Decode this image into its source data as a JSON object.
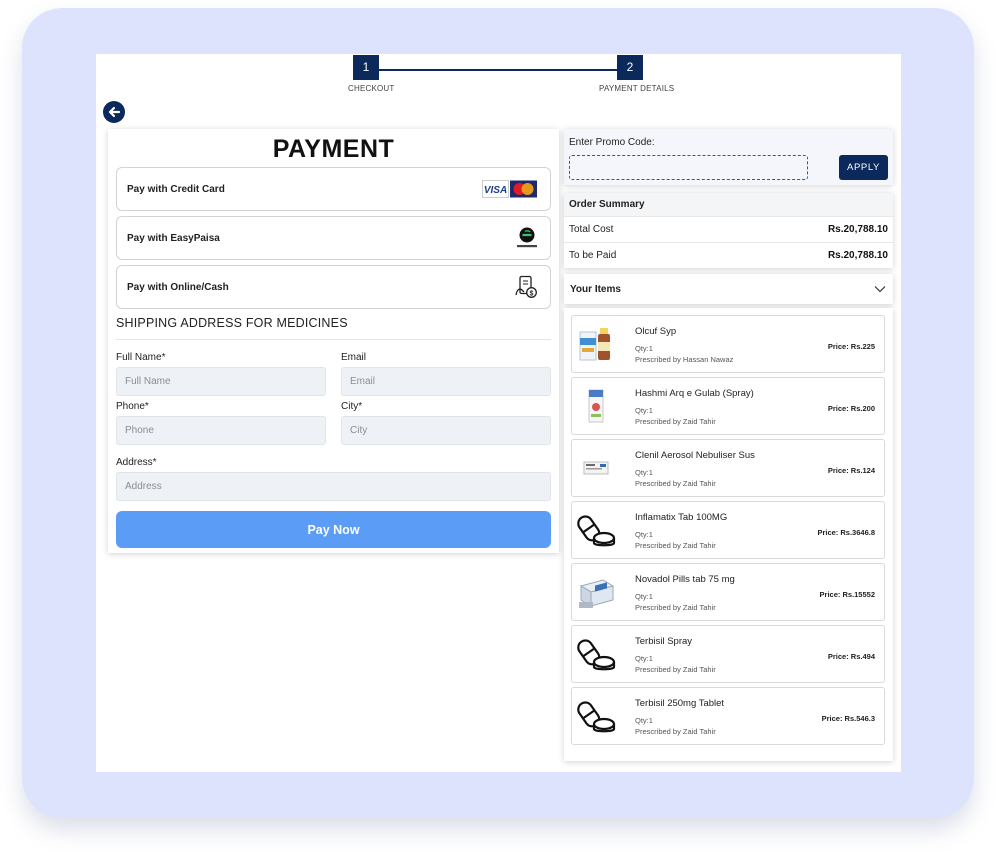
{
  "stepper": {
    "steps": [
      {
        "number": "1",
        "label": "CHECKOUT"
      },
      {
        "number": "2",
        "label": "PAYMENT DETAILS"
      }
    ]
  },
  "payment": {
    "title": "PAYMENT",
    "options": [
      {
        "label": "Pay with Credit Card",
        "icon": "visa-mastercard-icon"
      },
      {
        "label": "Pay with EasyPaisa",
        "icon": "easypaisa-icon"
      },
      {
        "label": "Pay with Online/Cash",
        "icon": "cash-payment-icon"
      }
    ]
  },
  "shipping": {
    "title": "SHIPPING ADDRESS FOR MEDICINES",
    "fields": {
      "full_name": {
        "label": "Full Name*",
        "placeholder": "Full Name"
      },
      "email": {
        "label": "Email",
        "placeholder": "Email"
      },
      "phone": {
        "label": "Phone*",
        "placeholder": "Phone"
      },
      "city": {
        "label": "City*",
        "placeholder": "City"
      },
      "address": {
        "label": "Address*",
        "placeholder": "Address"
      }
    },
    "submit_label": "Pay Now"
  },
  "promo": {
    "label": "Enter Promo Code:",
    "apply_label": "APPLY"
  },
  "summary": {
    "title": "Order Summary",
    "rows": [
      {
        "label": "Total Cost",
        "value": "Rs.20,788.10"
      },
      {
        "label": "To be Paid",
        "value": "Rs.20,788.10"
      }
    ]
  },
  "items": {
    "title": "Your Items",
    "list": [
      {
        "name": "Olcuf Syp",
        "qty": "Qty:1",
        "prescribed": "Prescribed by Hassan Nawaz",
        "price": "Price: Rs.225",
        "thumb": "syrup-bottle-image"
      },
      {
        "name": "Hashmi Arq e Gulab (Spray)",
        "qty": "Qty:1",
        "prescribed": "Prescribed by Zaid Tahir",
        "price": "Price: Rs.200",
        "thumb": "spray-box-image"
      },
      {
        "name": "Clenil Aerosol Nebuliser Sus",
        "qty": "Qty:1",
        "prescribed": "Prescribed by Zaid Tahir",
        "price": "Price: Rs.124",
        "thumb": "nebuliser-box-image"
      },
      {
        "name": "Inflamatix Tab 100MG",
        "qty": "Qty:1",
        "prescribed": "Prescribed by Zaid Tahir",
        "price": "Price: Rs.3646.8",
        "thumb": "pills-icon"
      },
      {
        "name": "Novadol Pills tab 75 mg",
        "qty": "Qty:1",
        "prescribed": "Prescribed by Zaid Tahir",
        "price": "Price: Rs.15552",
        "thumb": "tablet-box-image"
      },
      {
        "name": "Terbisil Spray",
        "qty": "Qty:1",
        "prescribed": "Prescribed by Zaid Tahir",
        "price": "Price: Rs.494",
        "thumb": "pills-icon"
      },
      {
        "name": "Terbisil 250mg Tablet",
        "qty": "Qty:1",
        "prescribed": "Prescribed by Zaid Tahir",
        "price": "Price: Rs.546.3",
        "thumb": "pills-icon"
      }
    ]
  },
  "colors": {
    "navy": "#0b2a5b",
    "pay_button": "#5b9cf7",
    "frame": "#dde3fd"
  }
}
